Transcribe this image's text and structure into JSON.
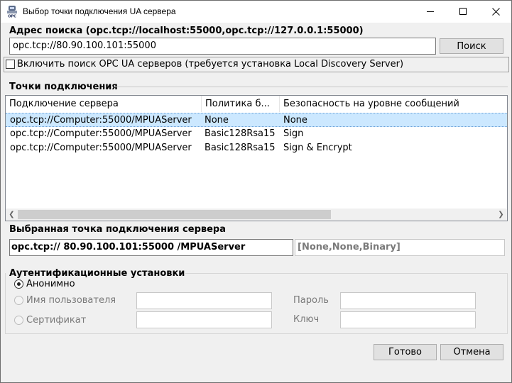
{
  "window": {
    "title": "Выбор точки подключения UA сервера"
  },
  "search": {
    "label": "Адрес поиска (opc.tcp://localhost:55000,opc.tcp://127.0.0.1:55000)",
    "value": "opc.tcp://80.90.100.101:55000",
    "button": "Поиск"
  },
  "discovery": {
    "checkbox_label": "Включить поиск OPC UA серверов (требуется установка Local Discovery Server)",
    "checked": false
  },
  "endpoints": {
    "group_label": "Точки подключения",
    "columns": [
      "Подключение сервера",
      "Политика б...",
      "Безопасность на уровне сообщений"
    ],
    "rows": [
      {
        "url": "opc.tcp://Computer:55000/MPUAServer",
        "policy": "None",
        "security": "None"
      },
      {
        "url": "opc.tcp://Computer:55000/MPUAServer",
        "policy": "Basic128Rsa15",
        "security": "Sign"
      },
      {
        "url": "opc.tcp://Computer:55000/MPUAServer",
        "policy": "Basic128Rsa15",
        "security": "Sign & Encrypt"
      }
    ],
    "selected_index": 0
  },
  "selected": {
    "label": "Выбранная точка подключения сервера",
    "value": "opc.tcp:// 80.90.100.101:55000 /MPUAServer",
    "info": "[None,None,Binary]"
  },
  "auth": {
    "group_label": "Аутентификационные установки",
    "anonymous": "Анонимно",
    "username": "Имя пользователя",
    "certificate": "Сертификат",
    "password_label": "Пароль",
    "key_label": "Ключ",
    "selected": "anonymous"
  },
  "buttons": {
    "ok": "Готово",
    "cancel": "Отмена"
  }
}
